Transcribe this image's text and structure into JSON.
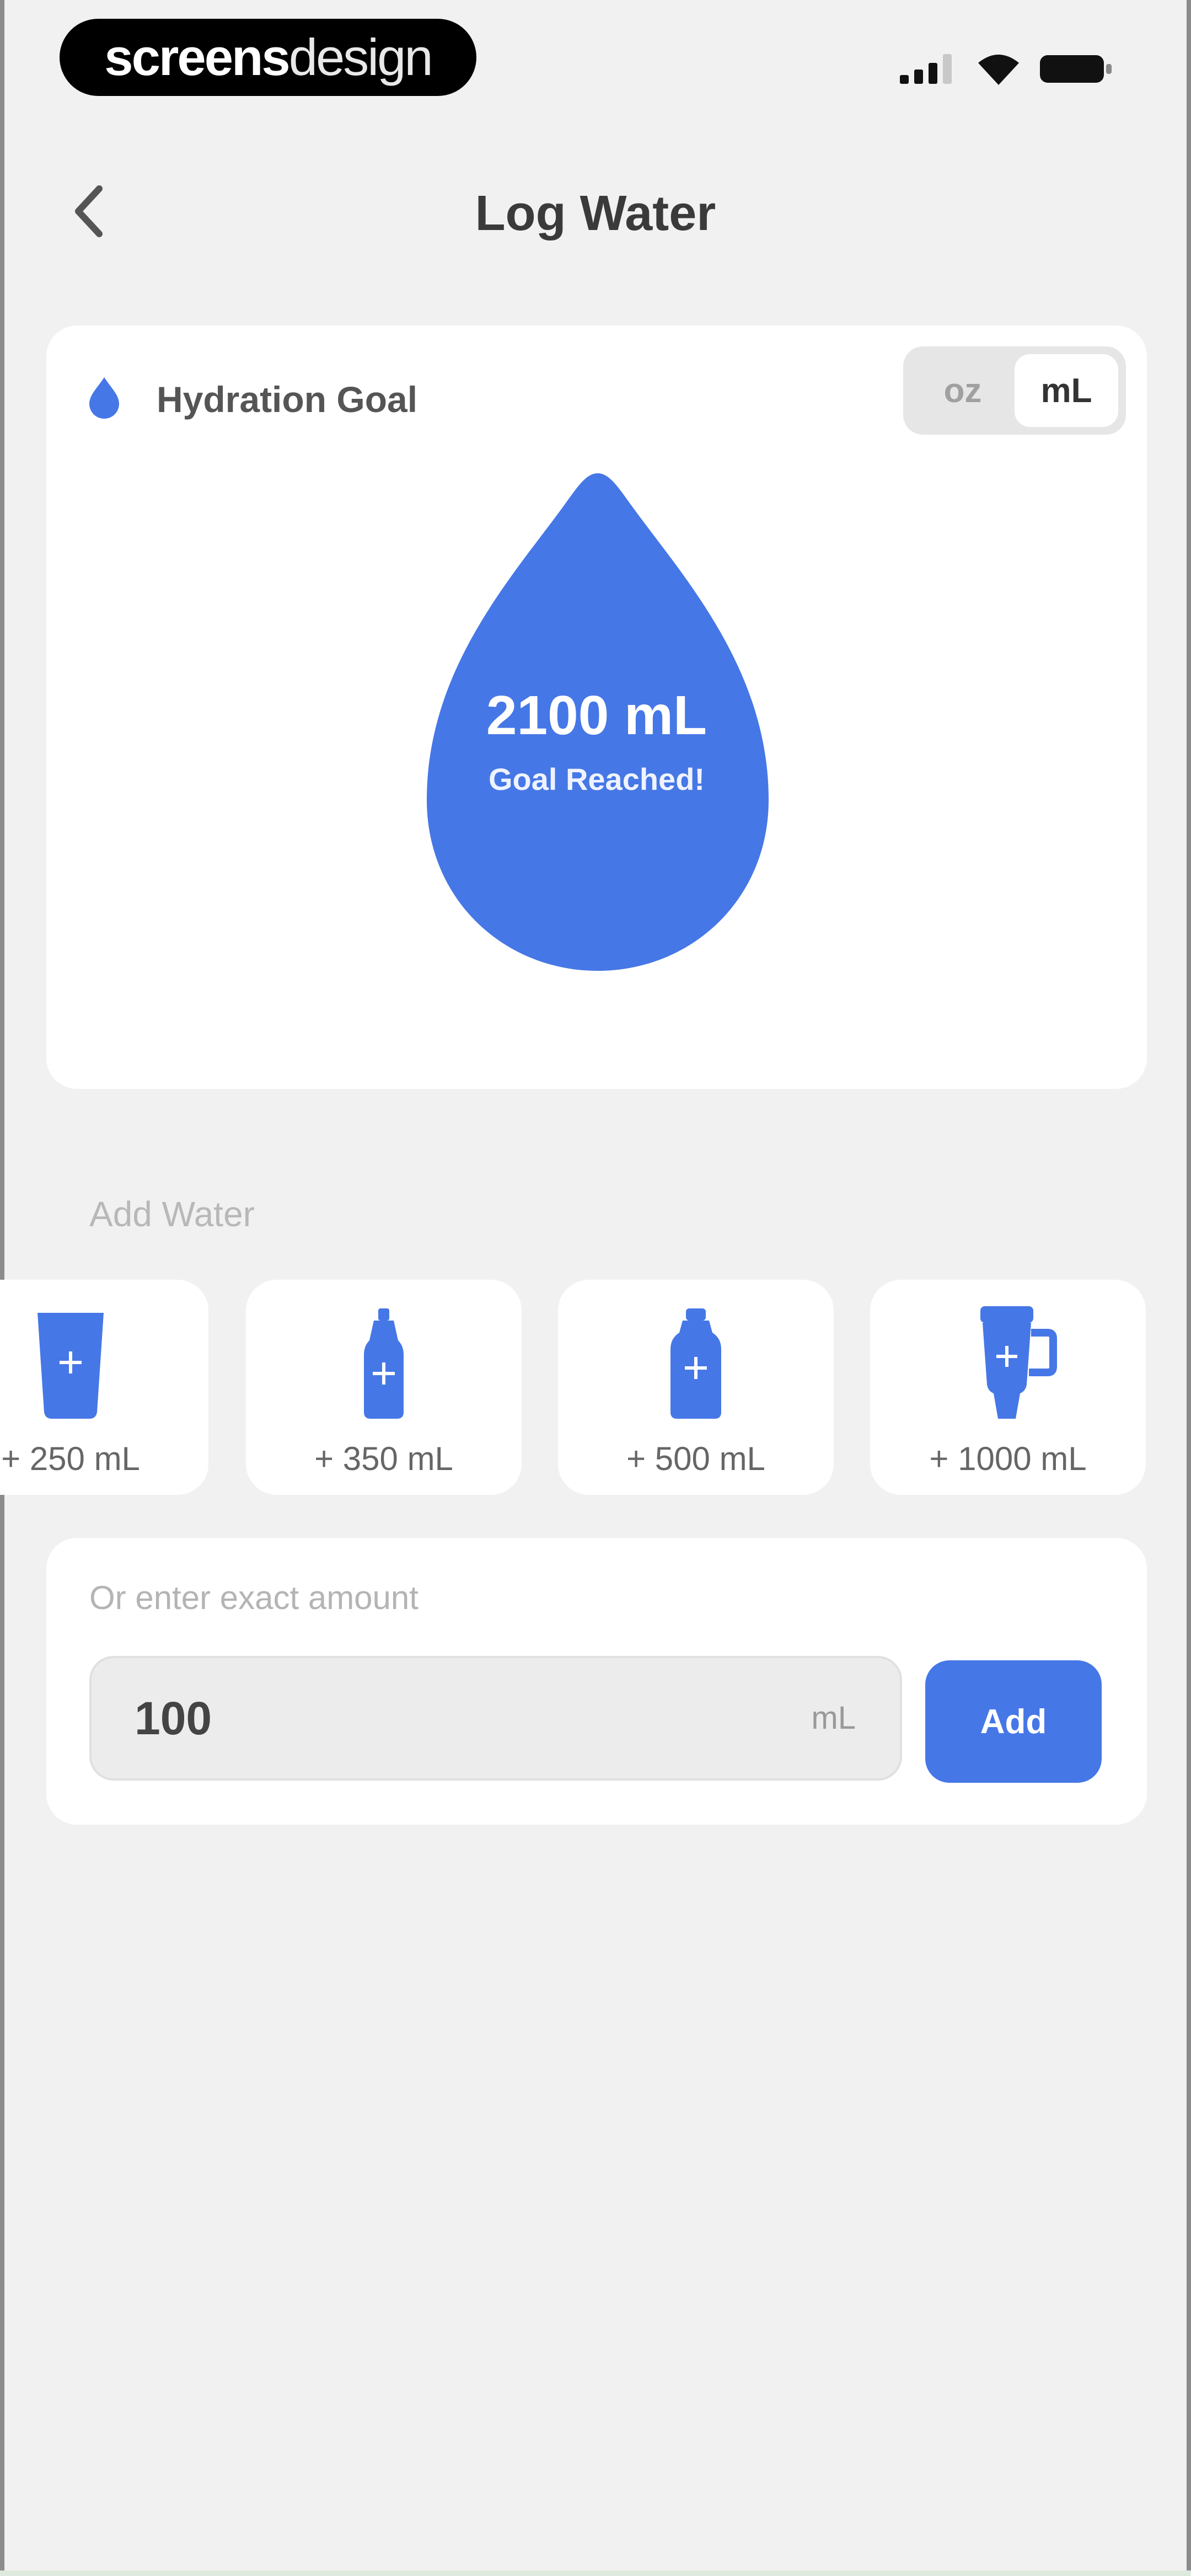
{
  "status_bar": {
    "brand_bold": "screens",
    "brand_light": "design"
  },
  "header": {
    "title": "Log Water",
    "back_icon": "chevron-left-icon"
  },
  "goal": {
    "label": "Hydration Goal",
    "units": {
      "oz_label": "oz",
      "ml_label": "mL",
      "selected": "mL"
    },
    "value": "2100 mL",
    "status": "Goal Reached!",
    "accent_color": "#4677e6"
  },
  "add_water": {
    "section_label": "Add Water",
    "presets": [
      {
        "label": "+ 250 mL",
        "icon": "cup-icon"
      },
      {
        "label": "+ 350 mL",
        "icon": "small-bottle-icon"
      },
      {
        "label": "+ 500 mL",
        "icon": "bottle-icon"
      },
      {
        "label": "+ 1000 mL",
        "icon": "tumbler-icon"
      }
    ]
  },
  "exact": {
    "label": "Or enter exact amount",
    "value": "100",
    "unit": "mL",
    "add_label": "Add"
  }
}
